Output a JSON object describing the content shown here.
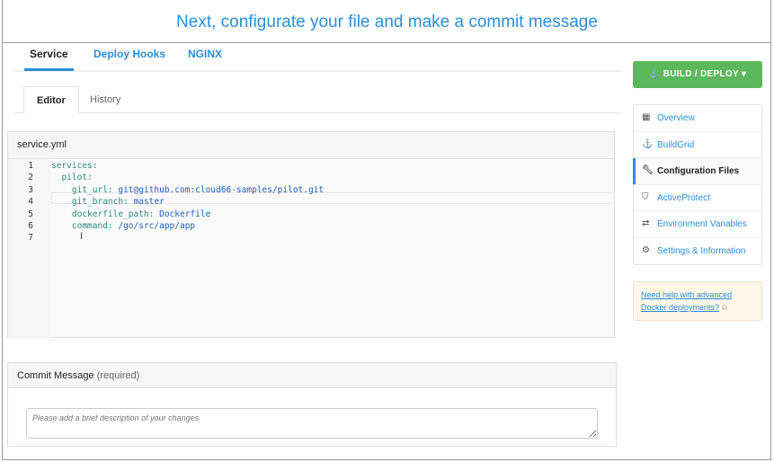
{
  "title": "Next, configurate your file and make a commit message",
  "tabs": [
    "Service",
    "Deploy Hooks",
    "NGINX"
  ],
  "subtabs": [
    "Editor",
    "History"
  ],
  "editor": {
    "filename": "service.yml",
    "lines": [
      {
        "n": "1",
        "key": "services:",
        "val": ""
      },
      {
        "n": "2",
        "key": "  pilot:",
        "val": ""
      },
      {
        "n": "3",
        "key": "    git_url:",
        "val": " git@github.com:cloud66-samples/pilot.git"
      },
      {
        "n": "4",
        "key": "    git_branch:",
        "val": " master"
      },
      {
        "n": "5",
        "key": "    dockerfile_path:",
        "val": " Dockerfile"
      },
      {
        "n": "6",
        "key": "    command:",
        "val": " /go/src/app/app"
      },
      {
        "n": "7",
        "key": "",
        "val": ""
      }
    ]
  },
  "commit": {
    "label": "Commit Message",
    "required": "(required)",
    "placeholder": "Please add a brief description of your changes"
  },
  "sidebar": {
    "build_label": "BUILD / DEPLOY",
    "items": [
      {
        "label": "Overview",
        "icon": "grid-icon"
      },
      {
        "label": "BuildGrid",
        "icon": "buildgrid-icon"
      },
      {
        "label": "Configuration Files",
        "icon": "wrench-icon"
      },
      {
        "label": "ActiveProtect",
        "icon": "shield-icon"
      },
      {
        "label": "Environment Variables",
        "icon": "exchange-icon"
      },
      {
        "label": "Settings & Information",
        "icon": "gear-icon"
      }
    ],
    "help_line1": "Need help with advanced",
    "help_line2": "Docker deployments?"
  },
  "colors": {
    "accent": "#2b8fd6",
    "build": "#5cb85c"
  }
}
